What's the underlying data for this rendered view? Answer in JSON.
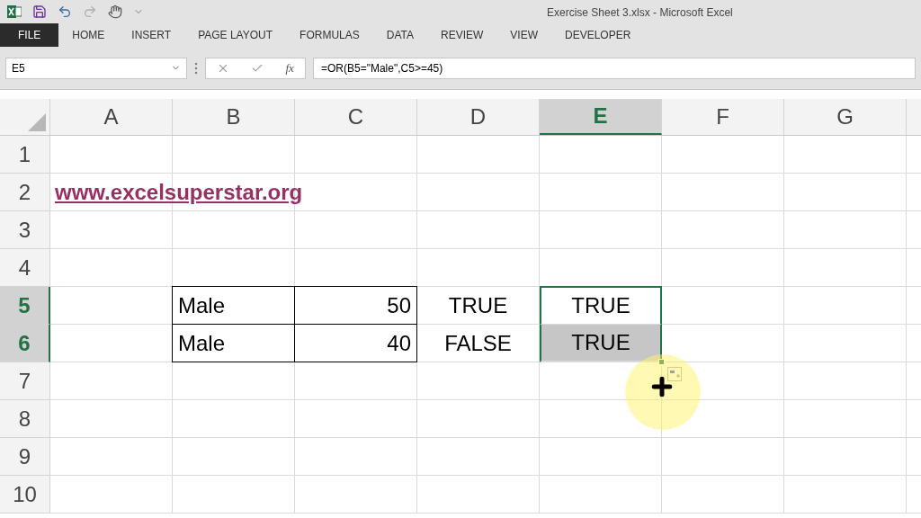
{
  "window": {
    "title": "Exercise Sheet 3.xlsx - Microsoft Excel"
  },
  "ribbon_tabs": [
    {
      "label": "FILE",
      "kind": "file",
      "selected": false
    },
    {
      "label": "HOME",
      "kind": "tab",
      "selected": false
    },
    {
      "label": "INSERT",
      "kind": "tab",
      "selected": false
    },
    {
      "label": "PAGE LAYOUT",
      "kind": "tab",
      "selected": false
    },
    {
      "label": "FORMULAS",
      "kind": "tab",
      "selected": false
    },
    {
      "label": "DATA",
      "kind": "tab",
      "selected": false
    },
    {
      "label": "REVIEW",
      "kind": "tab",
      "selected": false
    },
    {
      "label": "VIEW",
      "kind": "tab",
      "selected": false
    },
    {
      "label": "DEVELOPER",
      "kind": "tab",
      "selected": false
    }
  ],
  "formula_bar": {
    "name_box": "E5",
    "function_label": "fx",
    "formula": "=OR(B5=\"Male\",C5>=45)"
  },
  "columns": [
    {
      "label": "A",
      "selected": false
    },
    {
      "label": "B",
      "selected": false
    },
    {
      "label": "C",
      "selected": false
    },
    {
      "label": "D",
      "selected": false
    },
    {
      "label": "E",
      "selected": true
    },
    {
      "label": "F",
      "selected": false
    },
    {
      "label": "G",
      "selected": false
    }
  ],
  "rows": [
    {
      "label": "1",
      "selected": false
    },
    {
      "label": "2",
      "selected": false,
      "cells": [
        {
          "kind": "link",
          "text": "www.excelsuperstar.org"
        }
      ]
    },
    {
      "label": "3",
      "selected": false
    },
    {
      "label": "4",
      "selected": false
    },
    {
      "label": "5",
      "selected": true,
      "cells": [
        {
          "kind": "empty"
        },
        {
          "kind": "label",
          "text": "Male",
          "bordered": true,
          "selected": false
        },
        {
          "kind": "number",
          "text": "50",
          "bordered": true,
          "selected": false
        },
        {
          "kind": "boolean",
          "text": "TRUE",
          "bordered": false,
          "selected": false
        },
        {
          "kind": "boolean",
          "text": "TRUE",
          "bordered": false,
          "selected": true,
          "active": true
        }
      ]
    },
    {
      "label": "6",
      "selected": true,
      "cells": [
        {
          "kind": "empty"
        },
        {
          "kind": "label",
          "text": "Male",
          "bordered": true,
          "selected": false
        },
        {
          "kind": "number",
          "text": "40",
          "bordered": true,
          "selected": false
        },
        {
          "kind": "boolean",
          "text": "FALSE",
          "bordered": false,
          "selected": false
        },
        {
          "kind": "boolean",
          "text": "TRUE",
          "bordered": false,
          "selected": true,
          "active": false
        }
      ]
    },
    {
      "label": "7",
      "selected": false
    },
    {
      "label": "8",
      "selected": false
    },
    {
      "label": "9",
      "selected": false
    },
    {
      "label": "10",
      "selected": false
    }
  ]
}
